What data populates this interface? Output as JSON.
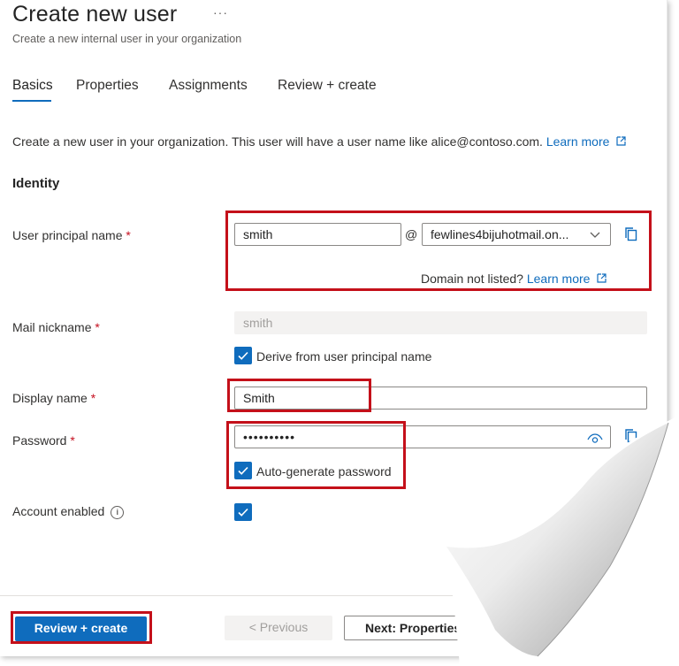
{
  "header": {
    "title": "Create new user",
    "more": "···",
    "subtitle": "Create a new internal user in your organization"
  },
  "tabs": [
    {
      "label": "Basics",
      "active": true
    },
    {
      "label": "Properties",
      "active": false
    },
    {
      "label": "Assignments",
      "active": false
    },
    {
      "label": "Review + create",
      "active": false
    }
  ],
  "description": {
    "text": "Create a new user in your organization. This user will have a user name like alice@contoso.com.",
    "link": "Learn more"
  },
  "identity": {
    "section_title": "Identity",
    "upn": {
      "label": "User principal name",
      "required": "*",
      "value": "smith",
      "at": "@",
      "domain": "fewlines4bijuhotmail.on...",
      "domain_hint": "Domain not listed?",
      "domain_link": "Learn more"
    },
    "mail_nickname": {
      "label": "Mail nickname",
      "required": "*",
      "value": "smith",
      "derive_label": "Derive from user principal name",
      "derive_checked": true
    },
    "display_name": {
      "label": "Display name",
      "required": "*",
      "value": "Smith"
    },
    "password": {
      "label": "Password",
      "required": "*",
      "value": "••••••••••",
      "autogen_label": "Auto-generate password",
      "autogen_checked": true
    },
    "account_enabled": {
      "label": "Account enabled",
      "info": "i",
      "checked": true
    }
  },
  "footer": {
    "review_create": "Review + create",
    "previous": "<  Previous",
    "next": "Next: Properties  >"
  },
  "colors": {
    "accent": "#0f6cbd",
    "highlight": "#c4101a",
    "required": "#c50f1f"
  }
}
